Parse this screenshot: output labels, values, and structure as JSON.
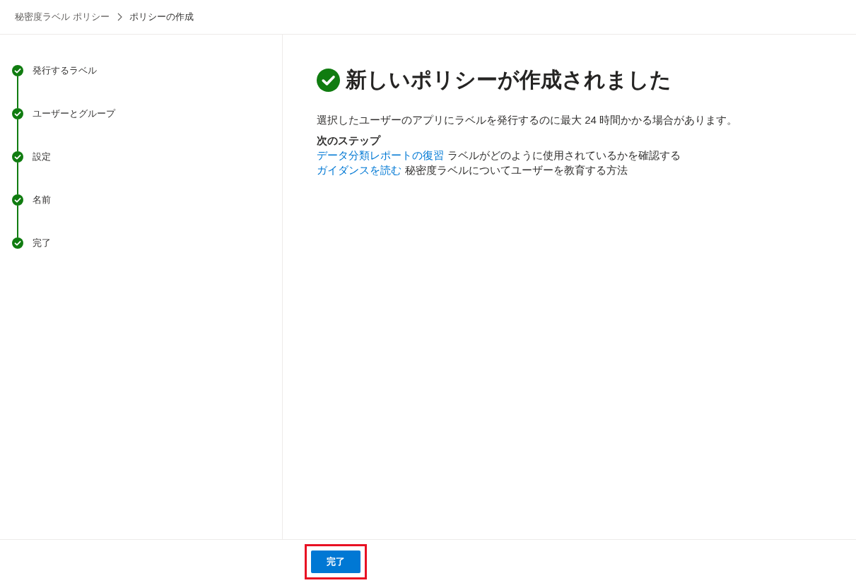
{
  "breadcrumb": [
    {
      "label": "秘密度ラベル ポリシー"
    },
    {
      "label": "ポリシーの作成"
    }
  ],
  "steps": [
    {
      "label": "発行するラベル",
      "completed": true
    },
    {
      "label": "ユーザーとグループ",
      "completed": true
    },
    {
      "label": "設定",
      "completed": true
    },
    {
      "label": "名前",
      "completed": true
    },
    {
      "label": "完了",
      "completed": true
    }
  ],
  "title": "新しいポリシーが作成されました",
  "message": "選択したユーザーのアプリにラベルを発行するのに最大 24 時間かかる場合があります。",
  "next_steps": {
    "heading": "次のステップ",
    "items": [
      {
        "link": "データ分類レポートの復習",
        "text": "ラベルがどのように使用されているかを確認する"
      },
      {
        "link": "ガイダンスを読む",
        "text": "秘密度ラベルについてユーザーを教育する方法"
      }
    ]
  },
  "footer": {
    "button": {
      "label": "完了",
      "highlighted": true
    }
  }
}
